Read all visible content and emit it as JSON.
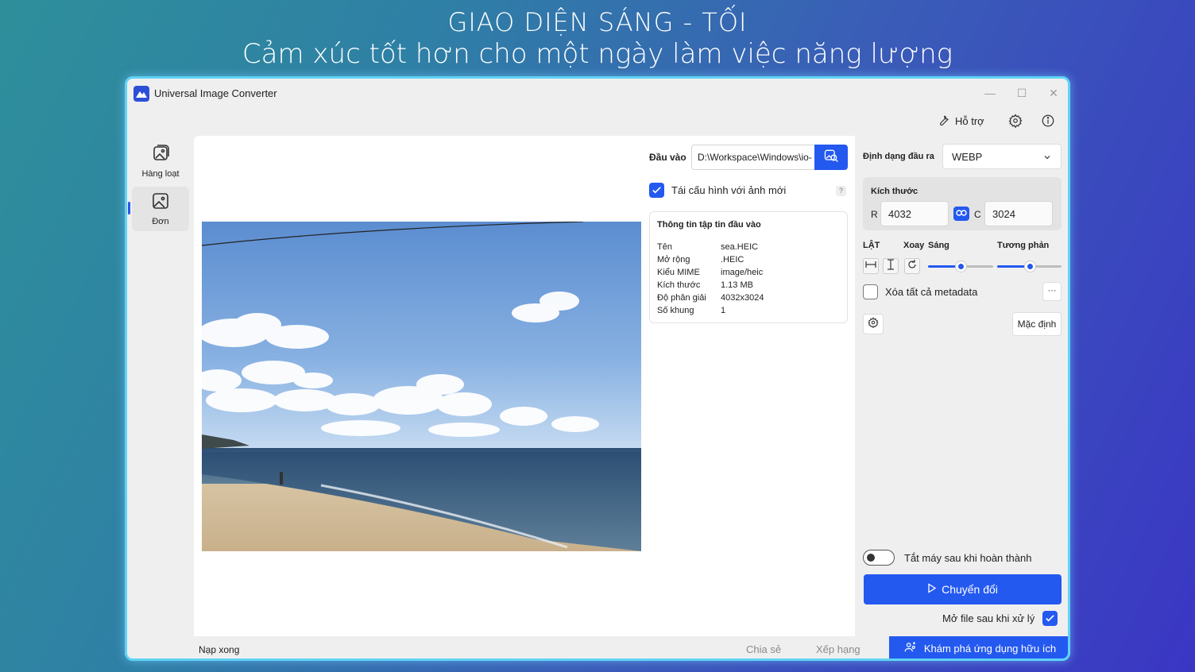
{
  "banner": {
    "line1": "GIAO DIỆN SÁNG - TỐI",
    "line2": "Cảm xúc tốt hơn cho một ngày làm việc năng lượng"
  },
  "window": {
    "title": "Universal Image Converter",
    "controls": {
      "minimize": "—",
      "maximize": "☐",
      "close": "✕"
    }
  },
  "toolbar": {
    "help_label": "Hỗ trợ",
    "icons": [
      "wrench-icon",
      "gear-icon",
      "info-icon"
    ]
  },
  "sidebar": {
    "items": [
      {
        "label": "Hàng loạt",
        "icon": "images-icon",
        "active": false
      },
      {
        "label": "Đơn",
        "icon": "image-icon",
        "active": true
      }
    ]
  },
  "input": {
    "label": "Đầu vào",
    "path": "D:\\Workspace\\Windows\\io-",
    "reconfigure_label": "Tái cấu hình với ảnh mới",
    "reconfigure_checked": true,
    "help": "?"
  },
  "file_info": {
    "title": "Thông tin tập tin đầu vào",
    "rows": [
      {
        "key": "Tên",
        "value": "sea.HEIC"
      },
      {
        "key": "Mở rộng",
        "value": ".HEIC"
      },
      {
        "key": "Kiểu MIME",
        "value": "image/heic"
      },
      {
        "key": "Kích thước",
        "value": "1.13 MB"
      },
      {
        "key": "Độ phân giải",
        "value": "4032x3024"
      },
      {
        "key": "Số khung",
        "value": "1"
      }
    ]
  },
  "output": {
    "format_label": "Định dạng đầu ra",
    "format_value": "WEBP",
    "size_label": "Kích thước",
    "width_prefix": "R",
    "width_value": "4032",
    "height_prefix": "C",
    "height_value": "3024",
    "flip_label": "LẬT",
    "rotate_label": "Xoay",
    "brightness_label": "Sáng",
    "contrast_label": "Tương phản",
    "brightness_level": 0.5,
    "contrast_level": 0.5,
    "remove_metadata_label": "Xóa tất cả metadata",
    "remove_metadata_checked": false,
    "more_label": "···",
    "default_label": "Mặc định",
    "shutdown_label": "Tắt máy sau khi hoàn thành",
    "shutdown_on": false,
    "convert_label": "Chuyển đổi",
    "open_after_label": "Mở file sau khi xử lý",
    "open_after_checked": true
  },
  "status": {
    "text": "Nạp xong",
    "share_label": "Chia sẻ",
    "rate_label": "Xếp hạng",
    "explore_label": "Khám phá ứng dụng hữu ích"
  },
  "colors": {
    "accent": "#2459f0",
    "window_border": "#5fd3f5"
  }
}
